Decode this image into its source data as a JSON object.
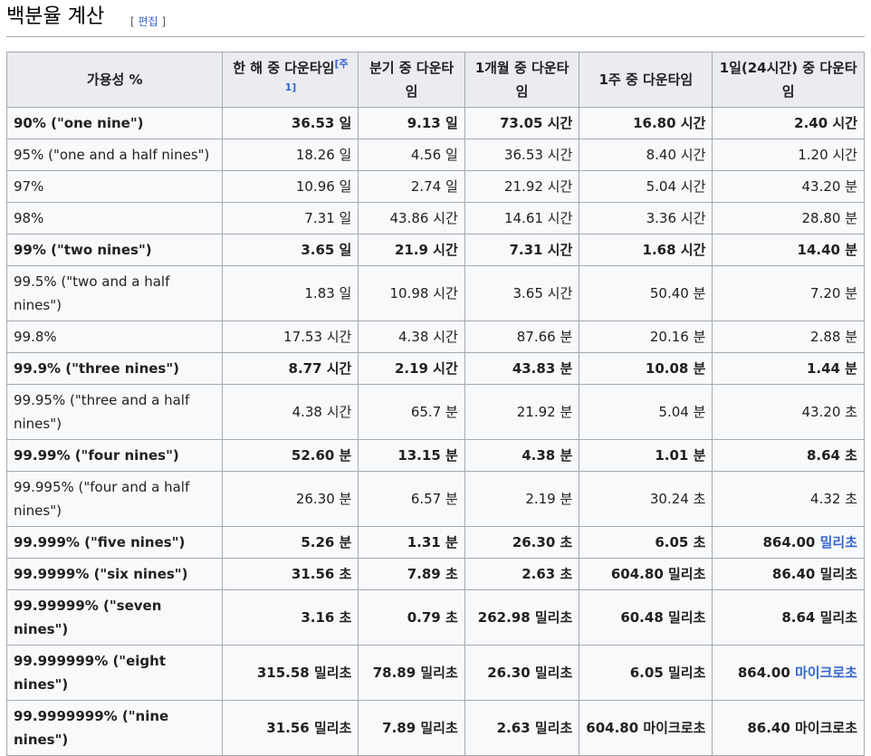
{
  "section": {
    "title": "백분율 계산",
    "edit_open": "[ ",
    "edit_label": "편집",
    "edit_close": " ]"
  },
  "table": {
    "headers": [
      {
        "text": "가용성 %"
      },
      {
        "text": "한 해 중 다운타임",
        "note": "[주 1]"
      },
      {
        "text": "분기 중 다운타임"
      },
      {
        "text": "1개월 중 다운타임"
      },
      {
        "text": "1주 중 다운타임"
      },
      {
        "text": "1일(24시간) 중 다운타임"
      }
    ],
    "rows": [
      {
        "bold": true,
        "cells": [
          "90% (\"one nine\")",
          "36.53 일",
          "9.13 일",
          "73.05 시간",
          "16.80 시간",
          "2.40 시간"
        ]
      },
      {
        "bold": false,
        "cells": [
          "95% (\"one and a half nines\")",
          "18.26 일",
          "4.56 일",
          "36.53 시간",
          "8.40 시간",
          "1.20 시간"
        ]
      },
      {
        "bold": false,
        "cells": [
          "97%",
          "10.96 일",
          "2.74 일",
          "21.92 시간",
          "5.04 시간",
          "43.20 분"
        ]
      },
      {
        "bold": false,
        "cells": [
          "98%",
          "7.31 일",
          "43.86 시간",
          "14.61 시간",
          "3.36 시간",
          "28.80 분"
        ]
      },
      {
        "bold": true,
        "cells": [
          "99% (\"two nines\")",
          "3.65 일",
          "21.9 시간",
          "7.31 시간",
          "1.68 시간",
          "14.40 분"
        ]
      },
      {
        "bold": false,
        "cells": [
          "99.5% (\"two and a half nines\")",
          "1.83 일",
          "10.98 시간",
          "3.65 시간",
          "50.40 분",
          "7.20 분"
        ]
      },
      {
        "bold": false,
        "cells": [
          "99.8%",
          "17.53 시간",
          "4.38 시간",
          "87.66 분",
          "20.16 분",
          "2.88 분"
        ]
      },
      {
        "bold": true,
        "cells": [
          "99.9% (\"three nines\")",
          "8.77 시간",
          "2.19 시간",
          "43.83 분",
          "10.08 분",
          "1.44 분"
        ]
      },
      {
        "bold": false,
        "tall": true,
        "cells": [
          "99.95% (\"three and a half nines\")",
          "4.38 시간",
          "65.7 분",
          "21.92 분",
          "5.04 분",
          "43.20 초"
        ]
      },
      {
        "bold": true,
        "cells": [
          "99.99% (\"four nines\")",
          "52.60 분",
          "13.15 분",
          "4.38 분",
          "1.01 분",
          "8.64 초"
        ]
      },
      {
        "bold": false,
        "tall": true,
        "cells": [
          "99.995% (\"four and a half nines\")",
          "26.30 분",
          "6.57 분",
          "2.19 분",
          "30.24 초",
          "4.32 초"
        ]
      },
      {
        "bold": true,
        "cells": [
          "99.999% (\"five nines\")",
          "5.26 분",
          "1.31 분",
          "26.30 초",
          "6.05 초",
          "864.00 "
        ],
        "last_link": "밀리초"
      },
      {
        "bold": true,
        "cells": [
          "99.9999% (\"six nines\")",
          "31.56 초",
          "7.89 초",
          "2.63 초",
          "604.80 밀리초",
          "86.40 밀리초"
        ]
      },
      {
        "bold": true,
        "cells": [
          "99.99999% (\"seven nines\")",
          "3.16 초",
          "0.79 초",
          "262.98 밀리초",
          "60.48 밀리초",
          "8.64 밀리초"
        ]
      },
      {
        "bold": true,
        "cells": [
          "99.999999% (\"eight nines\")",
          "315.58 밀리초",
          "78.89 밀리초",
          "26.30 밀리초",
          "6.05 밀리초",
          "864.00 "
        ],
        "last_link": "마이크로초"
      },
      {
        "bold": true,
        "tall": true,
        "cells": [
          "99.9999999% (\"nine nines\")",
          "31.56 밀리초",
          "7.89 밀리초",
          "2.63 밀리초",
          "604.80 마이크로초",
          "86.40 마이크로초"
        ]
      }
    ]
  }
}
